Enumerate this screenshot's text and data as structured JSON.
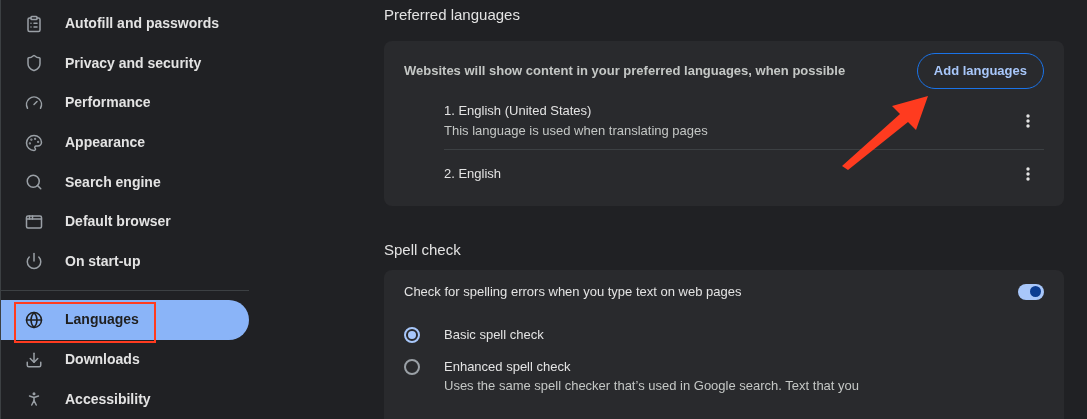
{
  "sidebar": {
    "items": [
      {
        "label": "Autofill and passwords",
        "selected": false
      },
      {
        "label": "Privacy and security",
        "selected": false
      },
      {
        "label": "Performance",
        "selected": false
      },
      {
        "label": "Appearance",
        "selected": false
      },
      {
        "label": "Search engine",
        "selected": false
      },
      {
        "label": "Default browser",
        "selected": false
      },
      {
        "label": "On start-up",
        "selected": false
      },
      {
        "label": "Languages",
        "selected": true
      },
      {
        "label": "Downloads",
        "selected": false
      },
      {
        "label": "Accessibility",
        "selected": false
      }
    ]
  },
  "preferred_languages": {
    "heading": "Preferred languages",
    "description": "Websites will show content in your preferred languages, when possible",
    "add_button": "Add languages",
    "languages": [
      {
        "name": "1. English (United States)",
        "note": "This language is used when translating pages"
      },
      {
        "name": "2. English"
      }
    ]
  },
  "spell_check": {
    "heading": "Spell check",
    "toggle_label": "Check for spelling errors when you type text on web pages",
    "on": true,
    "options": [
      {
        "label": "Basic spell check",
        "selected": true
      },
      {
        "label": "Enhanced spell check",
        "selected": false,
        "description": "Uses the same spell checker that’s used in Google search. Text that you"
      }
    ]
  }
}
